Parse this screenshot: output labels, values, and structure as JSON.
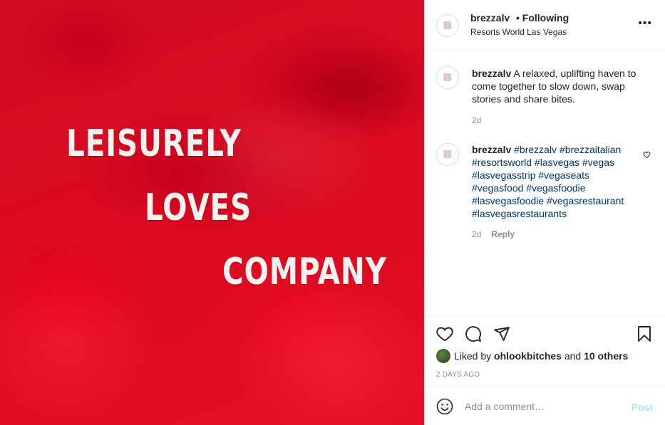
{
  "media": {
    "lines": [
      "LEISURELY",
      "LOVES",
      "COMPANY"
    ]
  },
  "header": {
    "username": "brezzalv",
    "separator": "•",
    "follow_status": "Following",
    "location": "Resorts World Las Vegas",
    "avatar_letter": "B",
    "more_icon": "more-options-icon"
  },
  "comments": [
    {
      "username": "brezzalv",
      "text": "A relaxed, uplifting haven to come together to slow down, swap stories and share bites.",
      "time": "2d"
    },
    {
      "username": "brezzalv",
      "hashtags": "#brezzalv #brezzaitalian #resortsworld #lasvegas #vegas #lasvegasstrip #vegaseats #vegasfood #vegasfoodie #lasvegasfoodie #vegasrestaurant #lasvegasrestaurants",
      "time": "2d",
      "reply_label": "Reply"
    }
  ],
  "actions": {
    "liked_prefix": "Liked by",
    "liked_user": "ohlookbitches",
    "liked_and": "and",
    "liked_others": "10 others",
    "date": "2 DAYS AGO"
  },
  "add_comment": {
    "placeholder": "Add a comment…",
    "post_label": "Post"
  },
  "colors": {
    "image_red": "#d90f22",
    "link": "#00376b",
    "post_disabled": "#b2dffc",
    "muted": "#8e8e8e"
  }
}
